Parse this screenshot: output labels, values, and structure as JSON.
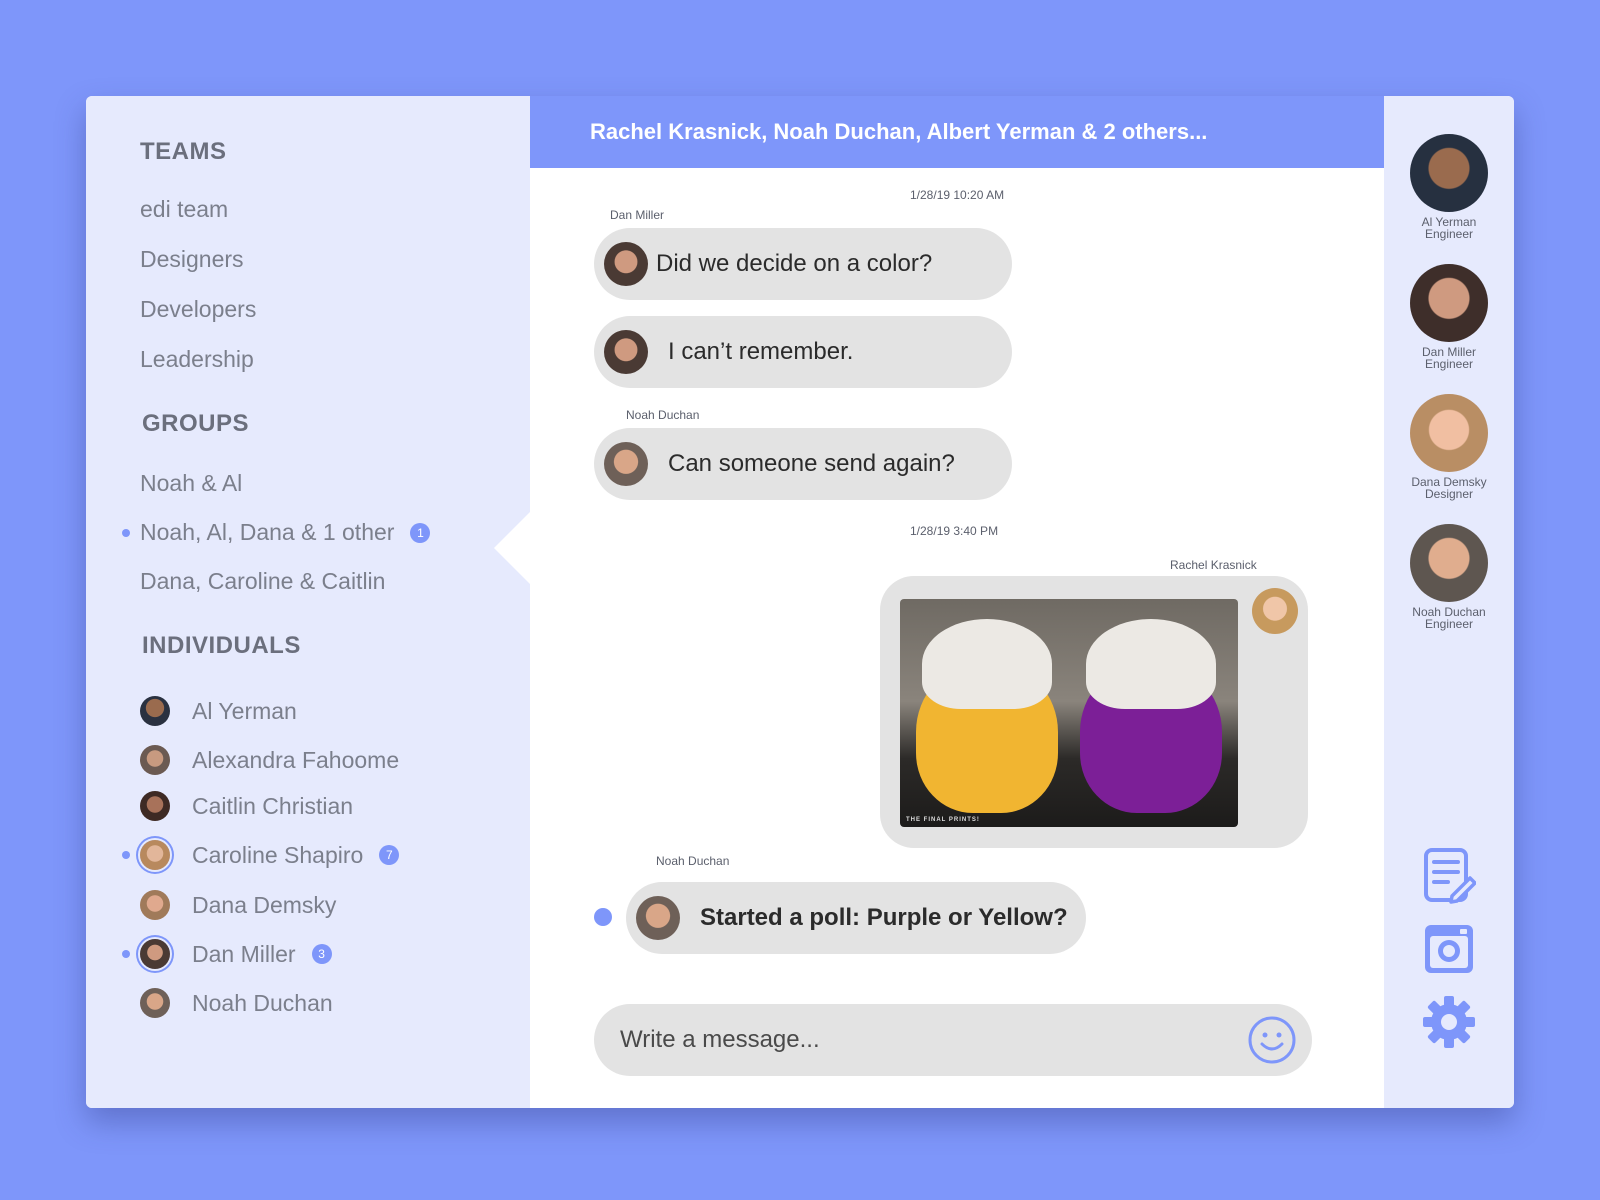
{
  "colors": {
    "accent": "#7e96fa",
    "bubble": "#e3e3e3",
    "sidebar": "#e6eafd"
  },
  "sidebar": {
    "teams_title": "TEAMS",
    "teams": [
      "edi team",
      "Designers",
      "Developers",
      "Leadership"
    ],
    "groups_title": "GROUPS",
    "groups": [
      {
        "label": "Noah & Al"
      },
      {
        "label": "Noah, Al, Dana & 1 other",
        "badge": "1"
      },
      {
        "label": "Dana, Caroline & Caitlin"
      }
    ],
    "individuals_title": "INDIVIDUALS",
    "individuals": [
      {
        "name": "Al Yerman"
      },
      {
        "name": "Alexandra Fahoome"
      },
      {
        "name": "Caitlin Christian"
      },
      {
        "name": "Caroline Shapiro",
        "badge": "7"
      },
      {
        "name": "Dana Demsky"
      },
      {
        "name": "Dan Miller",
        "badge": "3"
      },
      {
        "name": "Noah Duchan"
      }
    ]
  },
  "chat": {
    "title": "Rachel Krasnick, Noah Duchan, Albert Yerman & 2 others...",
    "messages": [
      {
        "timestamp": "1/28/19 10:20 AM",
        "sender": "Dan Miller",
        "text": "Did we decide on a color?"
      },
      {
        "text": "I can’t remember."
      },
      {
        "sender": "Noah Duchan",
        "text": "Can someone send again?"
      },
      {
        "timestamp": "1/28/19 3:40 PM",
        "sender": "Rachel Krasnick",
        "image_caption": "THE FINAL PRINTS!"
      },
      {
        "sender": "Noah Duchan",
        "text": "Started a poll: Purple or Yellow?"
      }
    ],
    "composer_placeholder": "Write a message..."
  },
  "members": [
    {
      "name": "Al Yerman",
      "role": "Engineer"
    },
    {
      "name": "Dan Miller",
      "role": "Engineer"
    },
    {
      "name": "Dana Demsky",
      "role": "Designer"
    },
    {
      "name": "Noah Duchan",
      "role": "Engineer"
    }
  ],
  "tools": [
    "notes-edit-icon",
    "instagram-icon",
    "gear-icon"
  ]
}
